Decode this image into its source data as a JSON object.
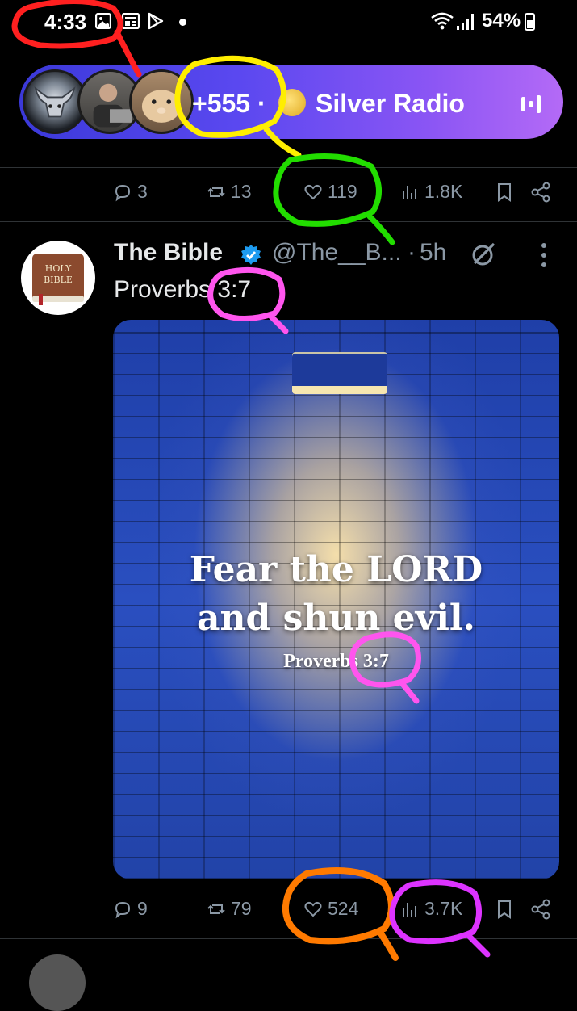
{
  "status_bar": {
    "time": "4:33",
    "battery": "54%",
    "icons": [
      "gallery-icon",
      "news-icon",
      "play-store-icon",
      "dot-icon",
      "wifi-icon",
      "signal-icon",
      "battery-icon"
    ]
  },
  "space_pill": {
    "listener_count": "+555 ·",
    "space_name": "Silver Radio",
    "icons": [
      "coin-icon",
      "equalizer-icon"
    ]
  },
  "prev_tweet_actions": {
    "replies": "3",
    "reposts": "13",
    "likes": "119",
    "views": "1.8K"
  },
  "tweet": {
    "author_name": "The Bible",
    "author_handle": "@The__B...",
    "separator": "·",
    "time": "5h",
    "text": "Proverbs 3:7",
    "avatar_text_1": "HOLY",
    "avatar_text_2": "BIBLE",
    "media": {
      "quote_line_1": "Fear the LORD",
      "quote_line_2": "and shun evil.",
      "reference": "Proverbs 3:7"
    },
    "actions": {
      "replies": "9",
      "reposts": "79",
      "likes": "524",
      "views": "3.7K"
    }
  },
  "annotation_colors": {
    "red": "#ff2020",
    "yellow": "#ffee00",
    "green": "#22dd00",
    "pink": "#ff55ee",
    "orange": "#ff7a00",
    "purple": "#dd33ff",
    "verified_blue": "#1d9bf0"
  }
}
